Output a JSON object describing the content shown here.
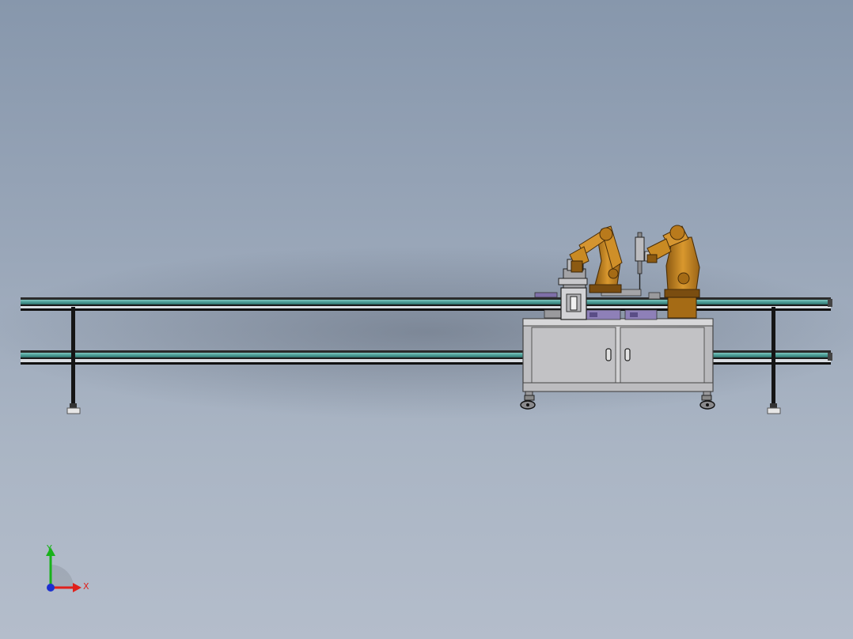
{
  "viewport": {
    "background_top": "#8797ac",
    "background_bottom": "#b4bdcb"
  },
  "model": {
    "conveyor_rail_color": "#4d9f98",
    "robot_color": "#c98a23",
    "robot_shadow_color": "#8c5a12",
    "cabinet_color": "#c7c7c9",
    "fixture_color": "#7e6fa8",
    "leg_color": "#151515"
  },
  "triad": {
    "x_label": "X",
    "y_label": "Y",
    "x_color": "#e0201b",
    "y_color": "#18b21a",
    "origin_color": "#1c2fd0"
  }
}
